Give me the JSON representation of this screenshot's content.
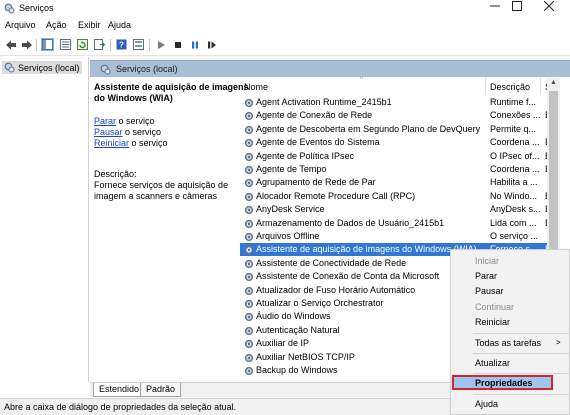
{
  "window": {
    "title": "Serviços",
    "controls": [
      "minimize",
      "maximize",
      "close"
    ]
  },
  "menu": [
    "Arquivo",
    "Ação",
    "Exibir",
    "Ajuda"
  ],
  "toolbar": {
    "icons": [
      "back-icon",
      "forward-icon",
      "console-tree-icon",
      "properties-icon",
      "export-icon",
      "refresh-icon",
      "help-icon",
      "view-icon",
      "play-icon",
      "stop-icon",
      "pause-icon",
      "restart-icon"
    ]
  },
  "tree": {
    "item": "Serviços (local)"
  },
  "content": {
    "header": "Serviços (local)",
    "selected_name": "Assistente de aquisição de imagens do Windows (WIA)",
    "actions": [
      {
        "link": "Parar",
        "rest": " o serviço"
      },
      {
        "link": "Pausar",
        "rest": " o serviço"
      },
      {
        "link": "Reiniciar",
        "rest": " o serviço"
      }
    ],
    "description_label": "Descrição:",
    "description_text": "Fornece serviços de aquisição de imagem a scanners e câmeras"
  },
  "list": {
    "columns": [
      "Nome",
      "Descrição",
      "S"
    ],
    "rows": [
      {
        "name": "Agent Activation Runtime_2415b1",
        "desc": "Runtime f...",
        "status": "",
        "selected": false
      },
      {
        "name": "Agente de Conexão de Rede",
        "desc": "Conexões ...",
        "status": "E",
        "selected": false
      },
      {
        "name": "Agente de Descoberta em Segundo Plano de DevQuery",
        "desc": "Permite q...",
        "status": "",
        "selected": false
      },
      {
        "name": "Agente de Eventos do Sistema",
        "desc": "Coordena ...",
        "status": "E",
        "selected": false
      },
      {
        "name": "Agente de Política IPsec",
        "desc": "O IPsec of...",
        "status": "E",
        "selected": false
      },
      {
        "name": "Agente de Tempo",
        "desc": "Coordena ...",
        "status": "E",
        "selected": false
      },
      {
        "name": "Agrupamento de Rede de Par",
        "desc": "Habilita a ...",
        "status": "",
        "selected": false
      },
      {
        "name": "Alocador Remote Procedure Call (RPC)",
        "desc": "No Windo...",
        "status": "E",
        "selected": false
      },
      {
        "name": "AnyDesk Service",
        "desc": "AnyDesk s...",
        "status": "E",
        "selected": false
      },
      {
        "name": "Armazenamento de Dados de Usuário_2415b1",
        "desc": "Lida com ...",
        "status": "E",
        "selected": false
      },
      {
        "name": "Arquivos Offline",
        "desc": "O serviço ...",
        "status": "",
        "selected": false
      },
      {
        "name": "Assistente de aquisição de imagens do Windows (WIA)",
        "desc": "Fornece s...",
        "status": "E",
        "selected": true
      },
      {
        "name": "Assistente de Conectividade de Rede",
        "desc": "",
        "status": "",
        "selected": false
      },
      {
        "name": "Assistente de Conexão de Conta da Microsoft",
        "desc": "",
        "status": "",
        "selected": false
      },
      {
        "name": "Atualizador de Fuso Horário Automático",
        "desc": "",
        "status": "",
        "selected": false
      },
      {
        "name": "Atualizar o Serviço Orchestrator",
        "desc": "",
        "status": "",
        "selected": false
      },
      {
        "name": "Áudio do Windows",
        "desc": "",
        "status": "",
        "selected": false
      },
      {
        "name": "Autenticação Natural",
        "desc": "",
        "status": "",
        "selected": false
      },
      {
        "name": "Auxiliar de IP",
        "desc": "",
        "status": "",
        "selected": false
      },
      {
        "name": "Auxiliar NetBIOS TCP/IP",
        "desc": "",
        "status": "",
        "selected": false
      },
      {
        "name": "Backup do Windows",
        "desc": "",
        "status": "",
        "selected": false
      }
    ]
  },
  "tabs": [
    "Estendido",
    "Padrão"
  ],
  "status_bar": "Abre a caixa de diálogo de propriedades da seleção atual.",
  "context_menu": {
    "iniciar": "Iniciar",
    "parar": "Parar",
    "pausar": "Pausar",
    "continuar": "Continuar",
    "reiniciar": "Reiniciar",
    "todas_tarefas": "Todas as tarefas",
    "atualizar": "Atualizar",
    "propriedades": "Propriedades",
    "ajuda": "Ajuda"
  }
}
